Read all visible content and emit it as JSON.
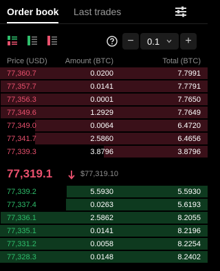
{
  "tabs": {
    "active": "Order book",
    "inactive": "Last trades"
  },
  "icons": {
    "settings": "sliders-icon",
    "views": [
      "both-sides-view-icon",
      "bids-only-view-icon",
      "asks-only-view-icon"
    ],
    "help": "help-icon",
    "caret": "chevron-down-icon",
    "mid_arrow": "arrow-down-icon"
  },
  "controls": {
    "minus": "−",
    "plus": "+",
    "tick": "0.1"
  },
  "headers": {
    "price": "Price (USD)",
    "amount": "Amount (BTC)",
    "total": "Total (BTC)"
  },
  "colors": {
    "ask": "#e8506d",
    "bid": "#2ebd6b",
    "ask_fill": "#3a1019",
    "bid_fill": "#0e3a1f"
  },
  "asks": [
    {
      "price": "77,360.7",
      "amount": "0.0200",
      "total": "7.7991",
      "depth": 1.0
    },
    {
      "price": "77,357.7",
      "amount": "0.0141",
      "total": "7.7791",
      "depth": 0.998
    },
    {
      "price": "77,356.3",
      "amount": "0.0001",
      "total": "7.7650",
      "depth": 0.996
    },
    {
      "price": "77,349.6",
      "amount": "1.2929",
      "total": "7.7649",
      "depth": 0.996
    },
    {
      "price": "77,349.0",
      "amount": "0.0064",
      "total": "6.4720",
      "depth": 0.83
    },
    {
      "price": "77,341.7",
      "amount": "2.5860",
      "total": "6.4656",
      "depth": 0.83
    },
    {
      "price": "77,339.3",
      "amount": "3.8796",
      "total": "3.8796",
      "depth": 0.5
    }
  ],
  "mid": {
    "price": "77,319.1",
    "reference": "$77,319.10"
  },
  "bids": [
    {
      "price": "77,339.2",
      "amount": "5.5930",
      "total": "5.5930",
      "depth": 0.68
    },
    {
      "price": "77,337.4",
      "amount": "0.0263",
      "total": "5.6193",
      "depth": 0.683
    },
    {
      "price": "77,336.1",
      "amount": "2.5862",
      "total": "8.2055",
      "depth": 0.997
    },
    {
      "price": "77,335.1",
      "amount": "0.0141",
      "total": "8.2196",
      "depth": 0.999
    },
    {
      "price": "77,331.2",
      "amount": "0.0058",
      "total": "8.2254",
      "depth": 0.9995
    },
    {
      "price": "77,328.3",
      "amount": "0.0148",
      "total": "8.2402",
      "depth": 1.0
    }
  ]
}
